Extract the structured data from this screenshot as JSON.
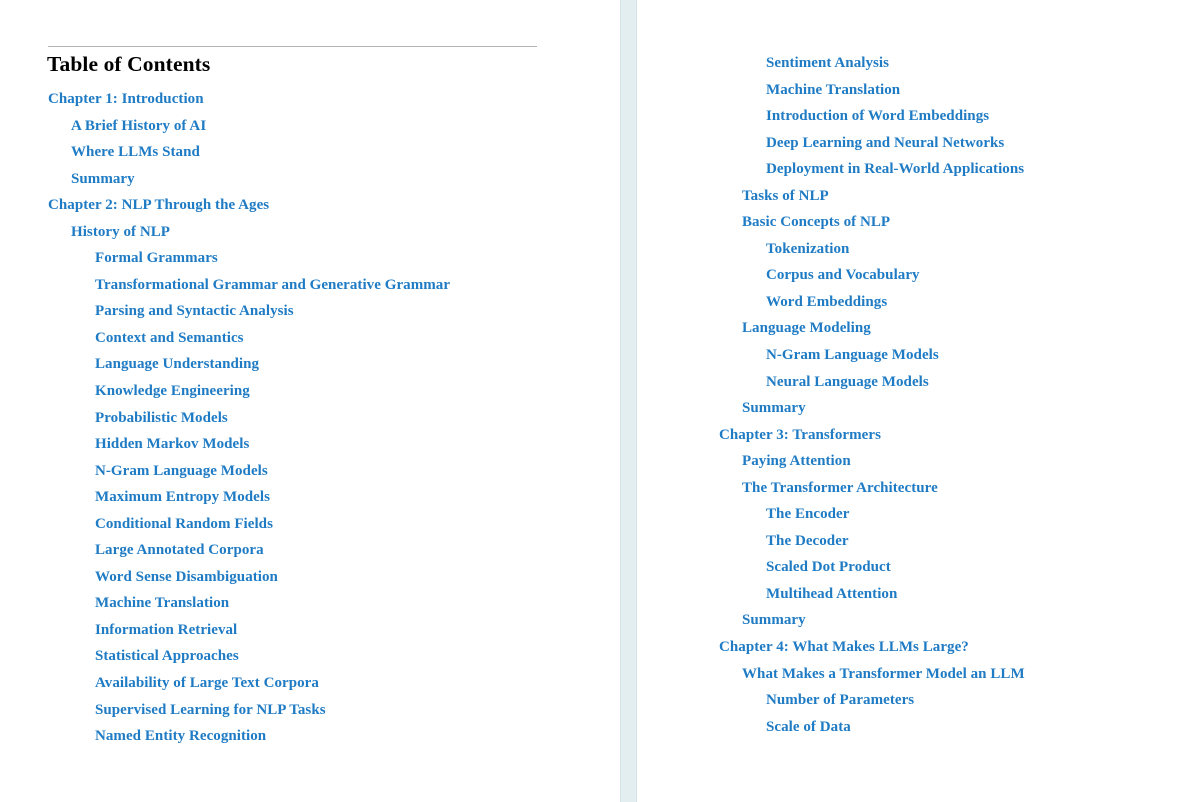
{
  "document": {
    "title": "Table of Contents",
    "link_color": "#1f7bc4",
    "title_color": "#000000",
    "rule_color": "#b4b4b4",
    "divider_color": "#e2eef0",
    "background_color": "#ffffff"
  },
  "left_column": {
    "entries": [
      {
        "label": "Chapter 1: Introduction",
        "level": 1
      },
      {
        "label": "A Brief History of AI",
        "level": 2
      },
      {
        "label": "Where LLMs Stand",
        "level": 2
      },
      {
        "label": "Summary",
        "level": 2
      },
      {
        "label": "Chapter 2: NLP Through the Ages",
        "level": 1
      },
      {
        "label": "History of NLP",
        "level": 2
      },
      {
        "label": "Formal Grammars",
        "level": 3
      },
      {
        "label": "Transformational Grammar and Generative Grammar",
        "level": 3
      },
      {
        "label": "Parsing and Syntactic Analysis",
        "level": 3
      },
      {
        "label": "Context and Semantics",
        "level": 3
      },
      {
        "label": "Language Understanding",
        "level": 3
      },
      {
        "label": "Knowledge Engineering",
        "level": 3
      },
      {
        "label": "Probabilistic Models",
        "level": 3
      },
      {
        "label": "Hidden Markov Models",
        "level": 3
      },
      {
        "label": "N-Gram Language Models",
        "level": 3
      },
      {
        "label": "Maximum Entropy Models",
        "level": 3
      },
      {
        "label": "Conditional Random Fields",
        "level": 3
      },
      {
        "label": "Large Annotated Corpora",
        "level": 3
      },
      {
        "label": "Word Sense Disambiguation",
        "level": 3
      },
      {
        "label": "Machine Translation",
        "level": 3
      },
      {
        "label": "Information Retrieval",
        "level": 3
      },
      {
        "label": "Statistical Approaches",
        "level": 3
      },
      {
        "label": "Availability of Large Text Corpora",
        "level": 3
      },
      {
        "label": "Supervised Learning for NLP Tasks",
        "level": 3
      },
      {
        "label": "Named Entity Recognition",
        "level": 3
      }
    ]
  },
  "right_column": {
    "entries": [
      {
        "label": "Sentiment Analysis",
        "level": 3
      },
      {
        "label": "Machine Translation",
        "level": 3
      },
      {
        "label": "Introduction of Word Embeddings",
        "level": 3
      },
      {
        "label": "Deep Learning and Neural Networks",
        "level": 3
      },
      {
        "label": "Deployment in Real-World Applications",
        "level": 3
      },
      {
        "label": "Tasks of NLP",
        "level": 2
      },
      {
        "label": "Basic Concepts of NLP",
        "level": 2
      },
      {
        "label": "Tokenization",
        "level": 3
      },
      {
        "label": "Corpus and Vocabulary",
        "level": 3
      },
      {
        "label": "Word Embeddings",
        "level": 3
      },
      {
        "label": "Language Modeling",
        "level": 2
      },
      {
        "label": "N-Gram Language Models",
        "level": 3
      },
      {
        "label": "Neural Language Models",
        "level": 3
      },
      {
        "label": "Summary",
        "level": 2
      },
      {
        "label": "Chapter 3: Transformers",
        "level": 1
      },
      {
        "label": "Paying Attention",
        "level": 2
      },
      {
        "label": "The Transformer Architecture",
        "level": 2
      },
      {
        "label": "The Encoder",
        "level": 3
      },
      {
        "label": "The Decoder",
        "level": 3
      },
      {
        "label": "Scaled Dot Product",
        "level": 3
      },
      {
        "label": "Multihead Attention",
        "level": 3
      },
      {
        "label": "Summary",
        "level": 2
      },
      {
        "label": "Chapter 4: What Makes LLMs Large?",
        "level": 1
      },
      {
        "label": "What Makes a Transformer Model an LLM",
        "level": 2
      },
      {
        "label": "Number of Parameters",
        "level": 3
      },
      {
        "label": "Scale of Data",
        "level": 3
      }
    ]
  }
}
